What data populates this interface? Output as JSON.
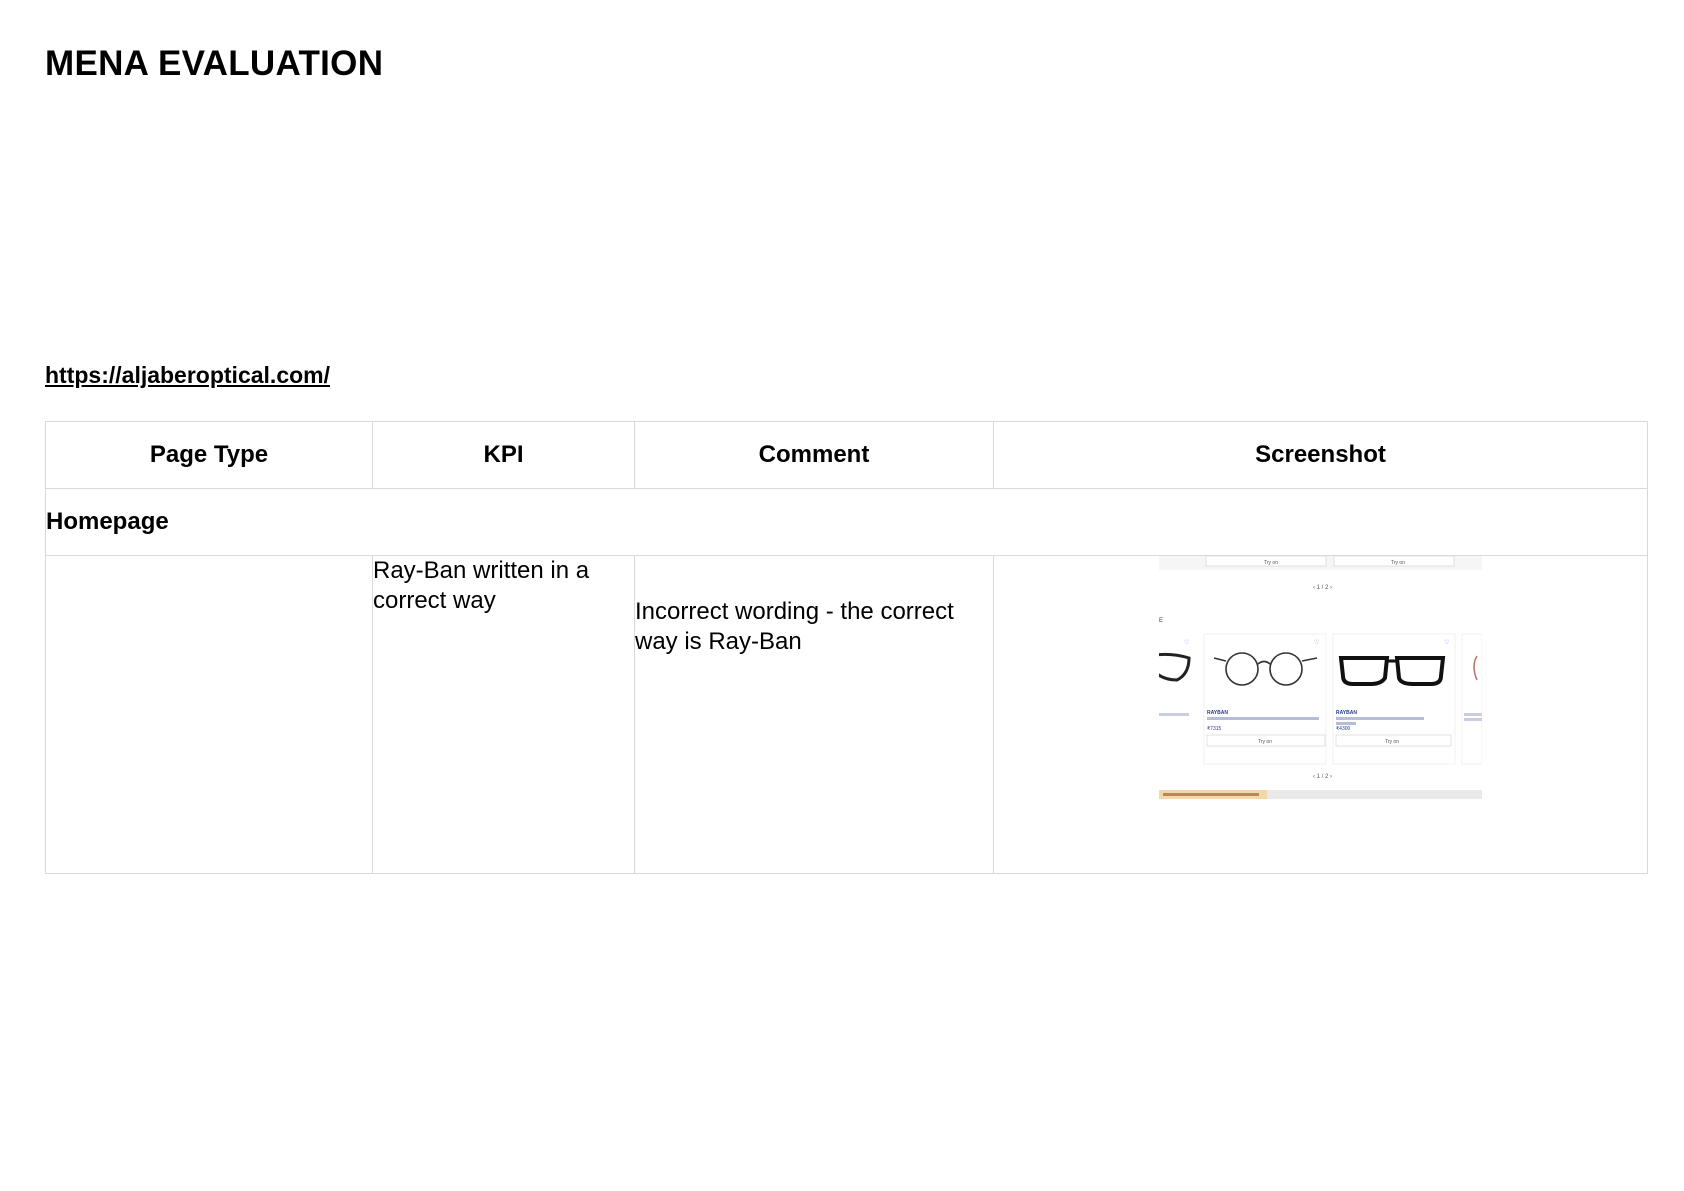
{
  "document": {
    "title": "MENA EVALUATION",
    "url": "https://aljaberoptical.com/"
  },
  "table": {
    "headers": [
      "Page Type",
      "KPI",
      "Comment",
      "Screenshot"
    ],
    "section": "Homepage",
    "rows": [
      {
        "page_type": "",
        "kpi": "Ray-Ban written in a correct way",
        "comment": "Incorrect wording - the correct way is Ray-Ban",
        "screenshot": {
          "pager_top": "‹ 1 / 2 ›",
          "pager_bottom": "‹ 1 / 2 ›",
          "brand_1": "RAYBAN",
          "brand_2": "RAYBAN",
          "price_1": "₹7315",
          "price_2": "₹4300",
          "button_label": "Try on",
          "frame_icons": [
            "glasses-round-icon",
            "glasses-rect-icon"
          ]
        }
      }
    ]
  }
}
